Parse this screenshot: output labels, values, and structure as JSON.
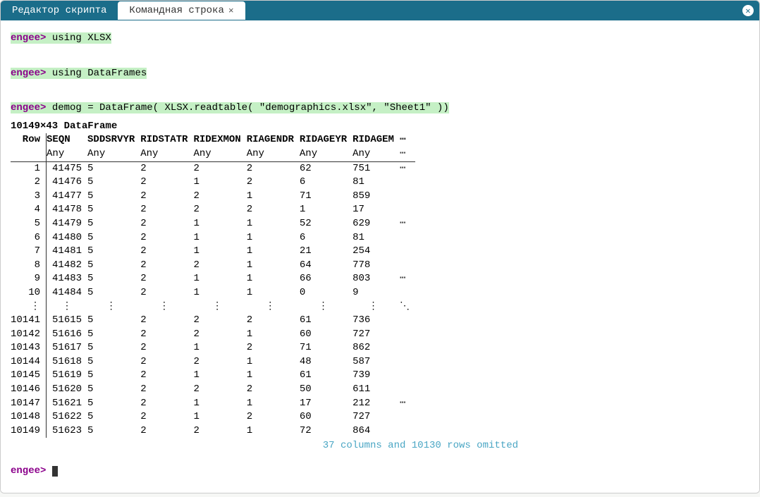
{
  "tabs": {
    "inactive": "Редактор скрипта",
    "active": "Командная строка"
  },
  "prompt": "engee>",
  "commands": {
    "c1": " using XLSX",
    "c2": " using DataFrames",
    "c3": " demog = DataFrame( XLSX.readtable( \"demographics.xlsx\", \"Sheet1\" ))"
  },
  "df": {
    "shape_label": "10149×43 DataFrame",
    "row_label": "Row",
    "columns": [
      "SEQN",
      "SDDSRVYR",
      "RIDSTATR",
      "RIDEXMON",
      "RIAGENDR",
      "RIDAGEYR",
      "RIDAGEM"
    ],
    "types": [
      "Any",
      "Any",
      "Any",
      "Any",
      "Any",
      "Any",
      "Any"
    ],
    "top_rows": [
      {
        "n": "1",
        "v": [
          "41475",
          "5",
          "2",
          "2",
          "2",
          "62",
          "751"
        ],
        "e": "⋯"
      },
      {
        "n": "2",
        "v": [
          "41476",
          "5",
          "2",
          "1",
          "2",
          "6",
          "81"
        ],
        "e": ""
      },
      {
        "n": "3",
        "v": [
          "41477",
          "5",
          "2",
          "2",
          "1",
          "71",
          "859"
        ],
        "e": ""
      },
      {
        "n": "4",
        "v": [
          "41478",
          "5",
          "2",
          "2",
          "2",
          "1",
          "17"
        ],
        "e": ""
      },
      {
        "n": "5",
        "v": [
          "41479",
          "5",
          "2",
          "1",
          "1",
          "52",
          "629"
        ],
        "e": "⋯"
      },
      {
        "n": "6",
        "v": [
          "41480",
          "5",
          "2",
          "1",
          "1",
          "6",
          "81"
        ],
        "e": ""
      },
      {
        "n": "7",
        "v": [
          "41481",
          "5",
          "2",
          "1",
          "1",
          "21",
          "254"
        ],
        "e": ""
      },
      {
        "n": "8",
        "v": [
          "41482",
          "5",
          "2",
          "2",
          "1",
          "64",
          "778"
        ],
        "e": ""
      },
      {
        "n": "9",
        "v": [
          "41483",
          "5",
          "2",
          "1",
          "1",
          "66",
          "803"
        ],
        "e": "⋯"
      },
      {
        "n": "10",
        "v": [
          "41484",
          "5",
          "2",
          "1",
          "1",
          "0",
          "9"
        ],
        "e": ""
      }
    ],
    "bottom_rows": [
      {
        "n": "10141",
        "v": [
          "51615",
          "5",
          "2",
          "2",
          "2",
          "61",
          "736"
        ],
        "e": ""
      },
      {
        "n": "10142",
        "v": [
          "51616",
          "5",
          "2",
          "2",
          "1",
          "60",
          "727"
        ],
        "e": ""
      },
      {
        "n": "10143",
        "v": [
          "51617",
          "5",
          "2",
          "1",
          "2",
          "71",
          "862"
        ],
        "e": ""
      },
      {
        "n": "10144",
        "v": [
          "51618",
          "5",
          "2",
          "2",
          "1",
          "48",
          "587"
        ],
        "e": ""
      },
      {
        "n": "10145",
        "v": [
          "51619",
          "5",
          "2",
          "1",
          "1",
          "61",
          "739"
        ],
        "e": ""
      },
      {
        "n": "10146",
        "v": [
          "51620",
          "5",
          "2",
          "2",
          "2",
          "50",
          "611"
        ],
        "e": ""
      },
      {
        "n": "10147",
        "v": [
          "51621",
          "5",
          "2",
          "1",
          "1",
          "17",
          "212"
        ],
        "e": "⋯"
      },
      {
        "n": "10148",
        "v": [
          "51622",
          "5",
          "2",
          "1",
          "2",
          "60",
          "727"
        ],
        "e": ""
      },
      {
        "n": "10149",
        "v": [
          "51623",
          "5",
          "2",
          "2",
          "1",
          "72",
          "864"
        ],
        "e": ""
      }
    ],
    "header_ellipsis": "⋯",
    "type_ellipsis": "⋯",
    "vdots": "⋮",
    "ddots": "⋱",
    "omitted": "37 columns and 10130 rows omitted"
  }
}
